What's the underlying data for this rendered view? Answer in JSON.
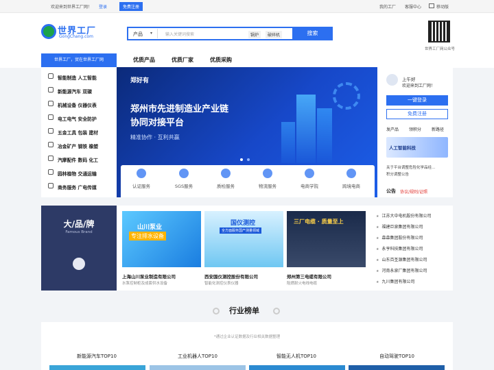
{
  "topbar": {
    "welcome": "欢迎来到世界工厂网！",
    "login": "登录",
    "register": "免费注册",
    "my_factory": "我的工厂",
    "service": "客服中心",
    "mobile": "移动版"
  },
  "header": {
    "logo_cn": "世界工厂",
    "logo_en": "GongChang.com",
    "search_type": "产品",
    "search_placeholder": "输入关键词搜索",
    "hot_tags": [
      "锅炉",
      "破碎机"
    ],
    "search_button": "搜索",
    "qr_caption": "世界工厂网公众号"
  },
  "nav": {
    "sidebar_title": "世界工厂，贸在世界工厂网",
    "items": [
      "优质产品",
      "优质厂家",
      "优质采购"
    ]
  },
  "sidebar": {
    "categories": [
      "智能制造  人工智能",
      "新能源汽车  双碳",
      "机械设备  仪器仪表",
      "电工电气  安全防护",
      "五金工具  包装  建材",
      "冶金矿产  钢铁  橡塑",
      "汽摩配件  数码  化工",
      "园林植物  交通运输",
      "商务服务  广电传媒"
    ]
  },
  "banner": {
    "brand": "郑好有",
    "title_line1": "郑州市先进制造业产业链",
    "title_line2": "协同对接平台",
    "subtitle": "精准协作 · 互利共赢"
  },
  "services": [
    "认证服务",
    "SGS服务",
    "质检服务",
    "物流服务",
    "电商学院",
    "跨境电商"
  ],
  "user": {
    "greeting": "上午好",
    "welcome": "欢迎来到工厂网！",
    "login_button": "一键登录",
    "register_button": "免费注册",
    "links": [
      "发产品",
      "领积分",
      "新路径"
    ],
    "ad_title": "人工智能科技",
    "notices": [
      "关于平台调整危险化学品经...",
      "积分调整公告"
    ],
    "announce_label": "公告",
    "announce_links": "协议/规则/证照"
  },
  "brands": {
    "title": "大/品/牌",
    "subtitle": "Famous Brand",
    "cards": [
      {
        "name": "上海山川泵业制造有限公司",
        "desc": "水泵控制柜及成套供水设备",
        "img_text1": "山川泵业",
        "img_text2": "专注排水设备"
      },
      {
        "name": "西安国仪测控股份有限公司",
        "desc": "智能化测控仪表仪器",
        "img_text1": "国仪测控",
        "img_text2": "全方面服务国产测量领域"
      },
      {
        "name": "郑州第三电缆有限公司",
        "desc": "阻燃耐火电线电缆",
        "img_text1": "三厂电缆 · 质量至上",
        "img_text2": ""
      }
    ],
    "list": [
      "江苏大中电机股份有限公司",
      "福建巨泉集团有限公司",
      "森森集团股份有限公司",
      "永亨科技集团有限公司",
      "山东百圣源集团有限公司",
      "河南永泉厂集团有限公司",
      "九川集团有限公司"
    ]
  },
  "rank": {
    "title": "行业榜单",
    "note": "*通过企业认证数据及行业相关数据整理",
    "tabs": [
      "新能源汽车TOP10",
      "工业机器人TOP10",
      "智能无人机TOP10",
      "自动驾驶TOP10"
    ]
  },
  "colors": {
    "primary": "#2c6ff0",
    "dark_blue": "#0b2a7a",
    "brand_bg": "#2d3a66"
  }
}
